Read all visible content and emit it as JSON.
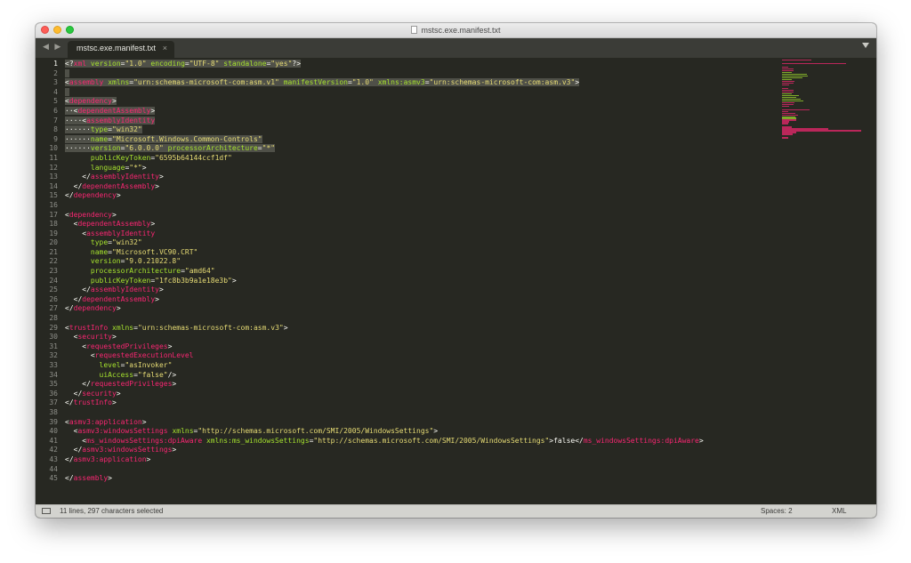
{
  "window": {
    "title": "mstsc.exe.manifest.txt"
  },
  "tab": {
    "label": "mstsc.exe.manifest.txt",
    "close": "×"
  },
  "nav": {
    "arrows": "◀ ▶"
  },
  "status": {
    "selection": "11 lines, 297 characters selected",
    "spaces": "Spaces: 2",
    "syntax": "XML"
  },
  "colors": {
    "background": "#272822",
    "tag": "#f92672",
    "attribute": "#a6e22e",
    "string": "#e6db74",
    "text": "#f8f8f2",
    "selection": "#4f5048"
  },
  "editor": {
    "current_line": 1,
    "lines": [
      {
        "n": "1",
        "sel": true,
        "t": [
          [
            "p",
            "<?"
          ],
          [
            "tag",
            "xml"
          ],
          [
            "p",
            " "
          ],
          [
            "attr",
            "version"
          ],
          [
            "p",
            "="
          ],
          [
            "str",
            "\"1.0\""
          ],
          [
            "p",
            " "
          ],
          [
            "attr",
            "encoding"
          ],
          [
            "p",
            "="
          ],
          [
            "str",
            "\"UTF-8\""
          ],
          [
            "p",
            " "
          ],
          [
            "attr",
            "standalone"
          ],
          [
            "p",
            "="
          ],
          [
            "str",
            "\"yes\""
          ],
          [
            "p",
            "?>"
          ]
        ]
      },
      {
        "n": "2",
        "sel": true,
        "t": []
      },
      {
        "n": "3",
        "sel": true,
        "t": [
          [
            "p",
            "<"
          ],
          [
            "tag",
            "assembly"
          ],
          [
            "p",
            " "
          ],
          [
            "attr",
            "xmlns"
          ],
          [
            "p",
            "="
          ],
          [
            "str",
            "\"urn:schemas-microsoft-com:asm.v1\""
          ],
          [
            "p",
            " "
          ],
          [
            "attr",
            "manifestVersion"
          ],
          [
            "p",
            "="
          ],
          [
            "str",
            "\"1.0\""
          ],
          [
            "p",
            " "
          ],
          [
            "attr",
            "xmlns:asmv3"
          ],
          [
            "p",
            "="
          ],
          [
            "str",
            "\"urn:schemas-microsoft-com:asm.v3\""
          ],
          [
            "p",
            ">"
          ]
        ]
      },
      {
        "n": "4",
        "sel": true,
        "t": []
      },
      {
        "n": "5",
        "sel": true,
        "t": [
          [
            "p",
            "<"
          ],
          [
            "tag",
            "dependency"
          ],
          [
            "p",
            ">"
          ]
        ]
      },
      {
        "n": "6",
        "sel": true,
        "t": [
          [
            "p",
            "··<"
          ],
          [
            "tag",
            "dependentAssembly"
          ],
          [
            "p",
            ">"
          ]
        ]
      },
      {
        "n": "7",
        "sel": true,
        "t": [
          [
            "p",
            "····<"
          ],
          [
            "tag",
            "assemblyIdentity"
          ]
        ]
      },
      {
        "n": "8",
        "sel": true,
        "t": [
          [
            "p",
            "······"
          ],
          [
            "attr",
            "type"
          ],
          [
            "p",
            "="
          ],
          [
            "str",
            "\"win32\""
          ]
        ]
      },
      {
        "n": "9",
        "sel": true,
        "t": [
          [
            "p",
            "······"
          ],
          [
            "attr",
            "name"
          ],
          [
            "p",
            "="
          ],
          [
            "str",
            "\"Microsoft.Windows.Common-Controls\""
          ]
        ]
      },
      {
        "n": "10",
        "sel": true,
        "t": [
          [
            "p",
            "······"
          ],
          [
            "attr",
            "version"
          ],
          [
            "p",
            "="
          ],
          [
            "str",
            "\"6.0.0.0\""
          ],
          [
            "p",
            " "
          ],
          [
            "attr",
            "processorArchitecture"
          ],
          [
            "p",
            "="
          ],
          [
            "str",
            "\"*\""
          ]
        ]
      },
      {
        "n": "11",
        "sel": false,
        "t": [
          [
            "p",
            "      "
          ],
          [
            "attr",
            "publicKeyToken"
          ],
          [
            "p",
            "="
          ],
          [
            "str",
            "\"6595b64144ccf1df\""
          ]
        ]
      },
      {
        "n": "12",
        "sel": false,
        "t": [
          [
            "p",
            "      "
          ],
          [
            "attr",
            "language"
          ],
          [
            "p",
            "="
          ],
          [
            "str",
            "\"*\""
          ],
          [
            "p",
            ">"
          ]
        ]
      },
      {
        "n": "13",
        "sel": false,
        "t": [
          [
            "p",
            "    </"
          ],
          [
            "tag",
            "assemblyIdentity"
          ],
          [
            "p",
            ">"
          ]
        ]
      },
      {
        "n": "14",
        "sel": false,
        "t": [
          [
            "p",
            "  </"
          ],
          [
            "tag",
            "dependentAssembly"
          ],
          [
            "p",
            ">"
          ]
        ]
      },
      {
        "n": "15",
        "sel": false,
        "t": [
          [
            "p",
            "</"
          ],
          [
            "tag",
            "dependency"
          ],
          [
            "p",
            ">"
          ]
        ]
      },
      {
        "n": "16",
        "sel": false,
        "t": []
      },
      {
        "n": "17",
        "sel": false,
        "t": [
          [
            "p",
            "<"
          ],
          [
            "tag",
            "dependency"
          ],
          [
            "p",
            ">"
          ]
        ]
      },
      {
        "n": "18",
        "sel": false,
        "t": [
          [
            "p",
            "  <"
          ],
          [
            "tag",
            "dependentAssembly"
          ],
          [
            "p",
            ">"
          ]
        ]
      },
      {
        "n": "19",
        "sel": false,
        "t": [
          [
            "p",
            "    <"
          ],
          [
            "tag",
            "assemblyIdentity"
          ]
        ]
      },
      {
        "n": "20",
        "sel": false,
        "t": [
          [
            "p",
            "      "
          ],
          [
            "attr",
            "type"
          ],
          [
            "p",
            "="
          ],
          [
            "str",
            "\"win32\""
          ]
        ]
      },
      {
        "n": "21",
        "sel": false,
        "t": [
          [
            "p",
            "      "
          ],
          [
            "attr",
            "name"
          ],
          [
            "p",
            "="
          ],
          [
            "str",
            "\"Microsoft.VC90.CRT\""
          ]
        ]
      },
      {
        "n": "22",
        "sel": false,
        "t": [
          [
            "p",
            "      "
          ],
          [
            "attr",
            "version"
          ],
          [
            "p",
            "="
          ],
          [
            "str",
            "\"9.0.21022.8\""
          ]
        ]
      },
      {
        "n": "23",
        "sel": false,
        "t": [
          [
            "p",
            "      "
          ],
          [
            "attr",
            "processorArchitecture"
          ],
          [
            "p",
            "="
          ],
          [
            "str",
            "\"amd64\""
          ]
        ]
      },
      {
        "n": "24",
        "sel": false,
        "t": [
          [
            "p",
            "      "
          ],
          [
            "attr",
            "publicKeyToken"
          ],
          [
            "p",
            "="
          ],
          [
            "str",
            "\"1fc8b3b9a1e18e3b\""
          ],
          [
            "p",
            ">"
          ]
        ]
      },
      {
        "n": "25",
        "sel": false,
        "t": [
          [
            "p",
            "    </"
          ],
          [
            "tag",
            "assemblyIdentity"
          ],
          [
            "p",
            ">"
          ]
        ]
      },
      {
        "n": "26",
        "sel": false,
        "t": [
          [
            "p",
            "  </"
          ],
          [
            "tag",
            "dependentAssembly"
          ],
          [
            "p",
            ">"
          ]
        ]
      },
      {
        "n": "27",
        "sel": false,
        "t": [
          [
            "p",
            "</"
          ],
          [
            "tag",
            "dependency"
          ],
          [
            "p",
            ">"
          ]
        ]
      },
      {
        "n": "28",
        "sel": false,
        "t": []
      },
      {
        "n": "29",
        "sel": false,
        "t": [
          [
            "p",
            "<"
          ],
          [
            "tag",
            "trustInfo"
          ],
          [
            "p",
            " "
          ],
          [
            "attr",
            "xmlns"
          ],
          [
            "p",
            "="
          ],
          [
            "str",
            "\"urn:schemas-microsoft-com:asm.v3\""
          ],
          [
            "p",
            ">"
          ]
        ]
      },
      {
        "n": "30",
        "sel": false,
        "t": [
          [
            "p",
            "  <"
          ],
          [
            "tag",
            "security"
          ],
          [
            "p",
            ">"
          ]
        ]
      },
      {
        "n": "31",
        "sel": false,
        "t": [
          [
            "p",
            "    <"
          ],
          [
            "tag",
            "requestedPrivileges"
          ],
          [
            "p",
            ">"
          ]
        ]
      },
      {
        "n": "32",
        "sel": false,
        "t": [
          [
            "p",
            "      <"
          ],
          [
            "tag",
            "requestedExecutionLevel"
          ]
        ]
      },
      {
        "n": "33",
        "sel": false,
        "t": [
          [
            "p",
            "        "
          ],
          [
            "attr",
            "level"
          ],
          [
            "p",
            "="
          ],
          [
            "str",
            "\"asInvoker\""
          ]
        ]
      },
      {
        "n": "34",
        "sel": false,
        "t": [
          [
            "p",
            "        "
          ],
          [
            "attr",
            "uiAccess"
          ],
          [
            "p",
            "="
          ],
          [
            "str",
            "\"false\""
          ],
          [
            "p",
            "/>"
          ]
        ]
      },
      {
        "n": "35",
        "sel": false,
        "t": [
          [
            "p",
            "    </"
          ],
          [
            "tag",
            "requestedPrivileges"
          ],
          [
            "p",
            ">"
          ]
        ]
      },
      {
        "n": "36",
        "sel": false,
        "t": [
          [
            "p",
            "  </"
          ],
          [
            "tag",
            "security"
          ],
          [
            "p",
            ">"
          ]
        ]
      },
      {
        "n": "37",
        "sel": false,
        "t": [
          [
            "p",
            "</"
          ],
          [
            "tag",
            "trustInfo"
          ],
          [
            "p",
            ">"
          ]
        ]
      },
      {
        "n": "38",
        "sel": false,
        "t": []
      },
      {
        "n": "39",
        "sel": false,
        "t": [
          [
            "p",
            "<"
          ],
          [
            "tag",
            "asmv3:application"
          ],
          [
            "p",
            ">"
          ]
        ]
      },
      {
        "n": "40",
        "sel": false,
        "t": [
          [
            "p",
            "  <"
          ],
          [
            "tag",
            "asmv3:windowsSettings"
          ],
          [
            "p",
            " "
          ],
          [
            "attr",
            "xmlns"
          ],
          [
            "p",
            "="
          ],
          [
            "str",
            "\"http://schemas.microsoft.com/SMI/2005/WindowsSettings\""
          ],
          [
            "p",
            ">"
          ]
        ]
      },
      {
        "n": "41",
        "sel": false,
        "t": [
          [
            "p",
            "    <"
          ],
          [
            "tag",
            "ms_windowsSettings:dpiAware"
          ],
          [
            "p",
            " "
          ],
          [
            "attr",
            "xmlns:ms_windowsSettings"
          ],
          [
            "p",
            "="
          ],
          [
            "str",
            "\"http://schemas.microsoft.com/SMI/2005/WindowsSettings\""
          ],
          [
            "p",
            ">false</"
          ],
          [
            "tag",
            "ms_windowsSettings:dpiAware"
          ],
          [
            "p",
            ">"
          ]
        ]
      },
      {
        "n": "42",
        "sel": false,
        "t": [
          [
            "p",
            "  </"
          ],
          [
            "tag",
            "asmv3:windowsSettings"
          ],
          [
            "p",
            ">"
          ]
        ]
      },
      {
        "n": "43",
        "sel": false,
        "t": [
          [
            "p",
            "</"
          ],
          [
            "tag",
            "asmv3:application"
          ],
          [
            "p",
            ">"
          ]
        ]
      },
      {
        "n": "44",
        "sel": false,
        "t": []
      },
      {
        "n": "45",
        "sel": false,
        "t": [
          [
            "p",
            "</"
          ],
          [
            "tag",
            "assembly"
          ],
          [
            "p",
            ">"
          ]
        ]
      }
    ]
  }
}
